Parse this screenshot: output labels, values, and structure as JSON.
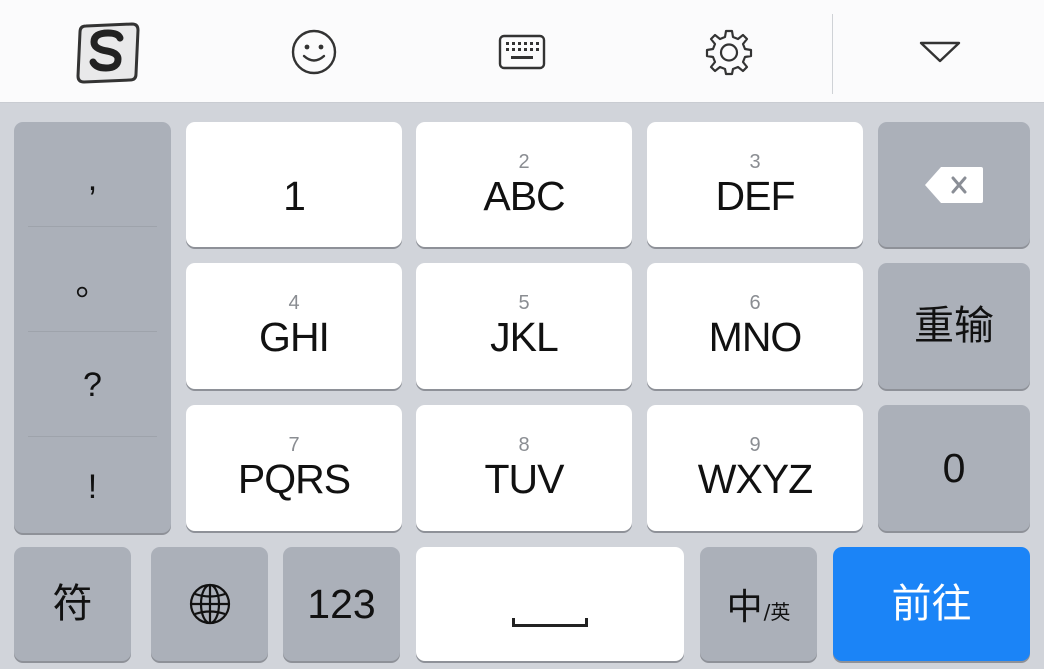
{
  "toolbar": {
    "items": [
      {
        "icon": "sogou-logo-icon"
      },
      {
        "icon": "emoji-icon"
      },
      {
        "icon": "keyboard-icon"
      },
      {
        "icon": "gear-icon"
      },
      {
        "icon": "chevron-down-icon"
      }
    ]
  },
  "punctuation": [
    ",",
    "。",
    "?",
    "!"
  ],
  "keys": [
    {
      "num": "",
      "letters": "1"
    },
    {
      "num": "2",
      "letters": "ABC"
    },
    {
      "num": "3",
      "letters": "DEF"
    },
    {
      "num": "4",
      "letters": "GHI"
    },
    {
      "num": "5",
      "letters": "JKL"
    },
    {
      "num": "6",
      "letters": "MNO"
    },
    {
      "num": "7",
      "letters": "PQRS"
    },
    {
      "num": "8",
      "letters": "TUV"
    },
    {
      "num": "9",
      "letters": "WXYZ"
    }
  ],
  "side": {
    "backspace_icon": "backspace-icon",
    "reinput": "重输",
    "zero": "0"
  },
  "bottom": {
    "symbols": "符",
    "globe_icon": "globe-icon",
    "numbers": "123",
    "lang_main": "中",
    "lang_sub": "/英",
    "go": "前往"
  },
  "colors": {
    "go_key": "#1b84f7",
    "white_key": "#ffffff",
    "function_key": "#abb0b9",
    "background": "#d1d4da"
  }
}
